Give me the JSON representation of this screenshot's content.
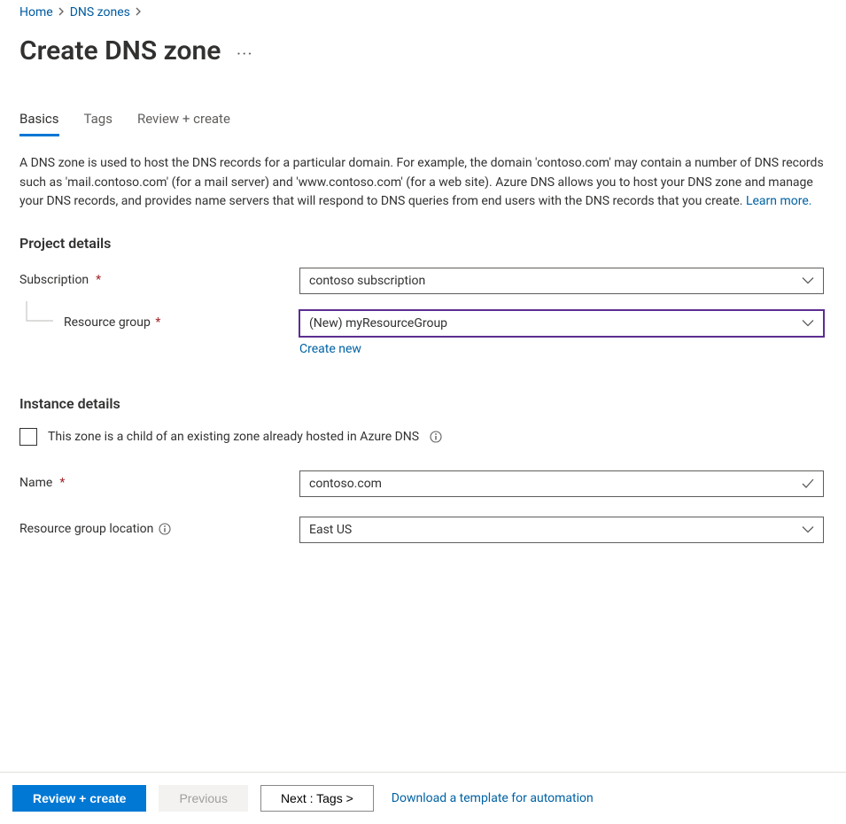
{
  "breadcrumb": {
    "items": [
      {
        "label": "Home"
      },
      {
        "label": "DNS zones"
      }
    ]
  },
  "page": {
    "title": "Create DNS zone"
  },
  "tabs": [
    {
      "label": "Basics",
      "active": true
    },
    {
      "label": "Tags",
      "active": false
    },
    {
      "label": "Review + create",
      "active": false
    }
  ],
  "description": {
    "text": "A DNS zone is used to host the DNS records for a particular domain. For example, the domain 'contoso.com' may contain a number of DNS records such as 'mail.contoso.com' (for a mail server) and 'www.contoso.com' (for a web site). Azure DNS allows you to host your DNS zone and manage your DNS records, and provides name servers that will respond to DNS queries from end users with the DNS records that you create.  ",
    "link": "Learn more."
  },
  "sections": {
    "project": {
      "heading": "Project details",
      "subscription_label": "Subscription",
      "subscription_value": "contoso subscription",
      "resource_group_label": "Resource group",
      "resource_group_value": "(New) myResourceGroup",
      "create_new_link": "Create new"
    },
    "instance": {
      "heading": "Instance details",
      "child_zone_label": "This zone is a child of an existing zone already hosted in Azure DNS",
      "name_label": "Name",
      "name_value": "contoso.com",
      "rg_location_label": "Resource group location",
      "rg_location_value": "East US"
    }
  },
  "footer": {
    "review_create": "Review + create",
    "previous": "Previous",
    "next": "Next : Tags >",
    "download_link": "Download a template for automation"
  }
}
